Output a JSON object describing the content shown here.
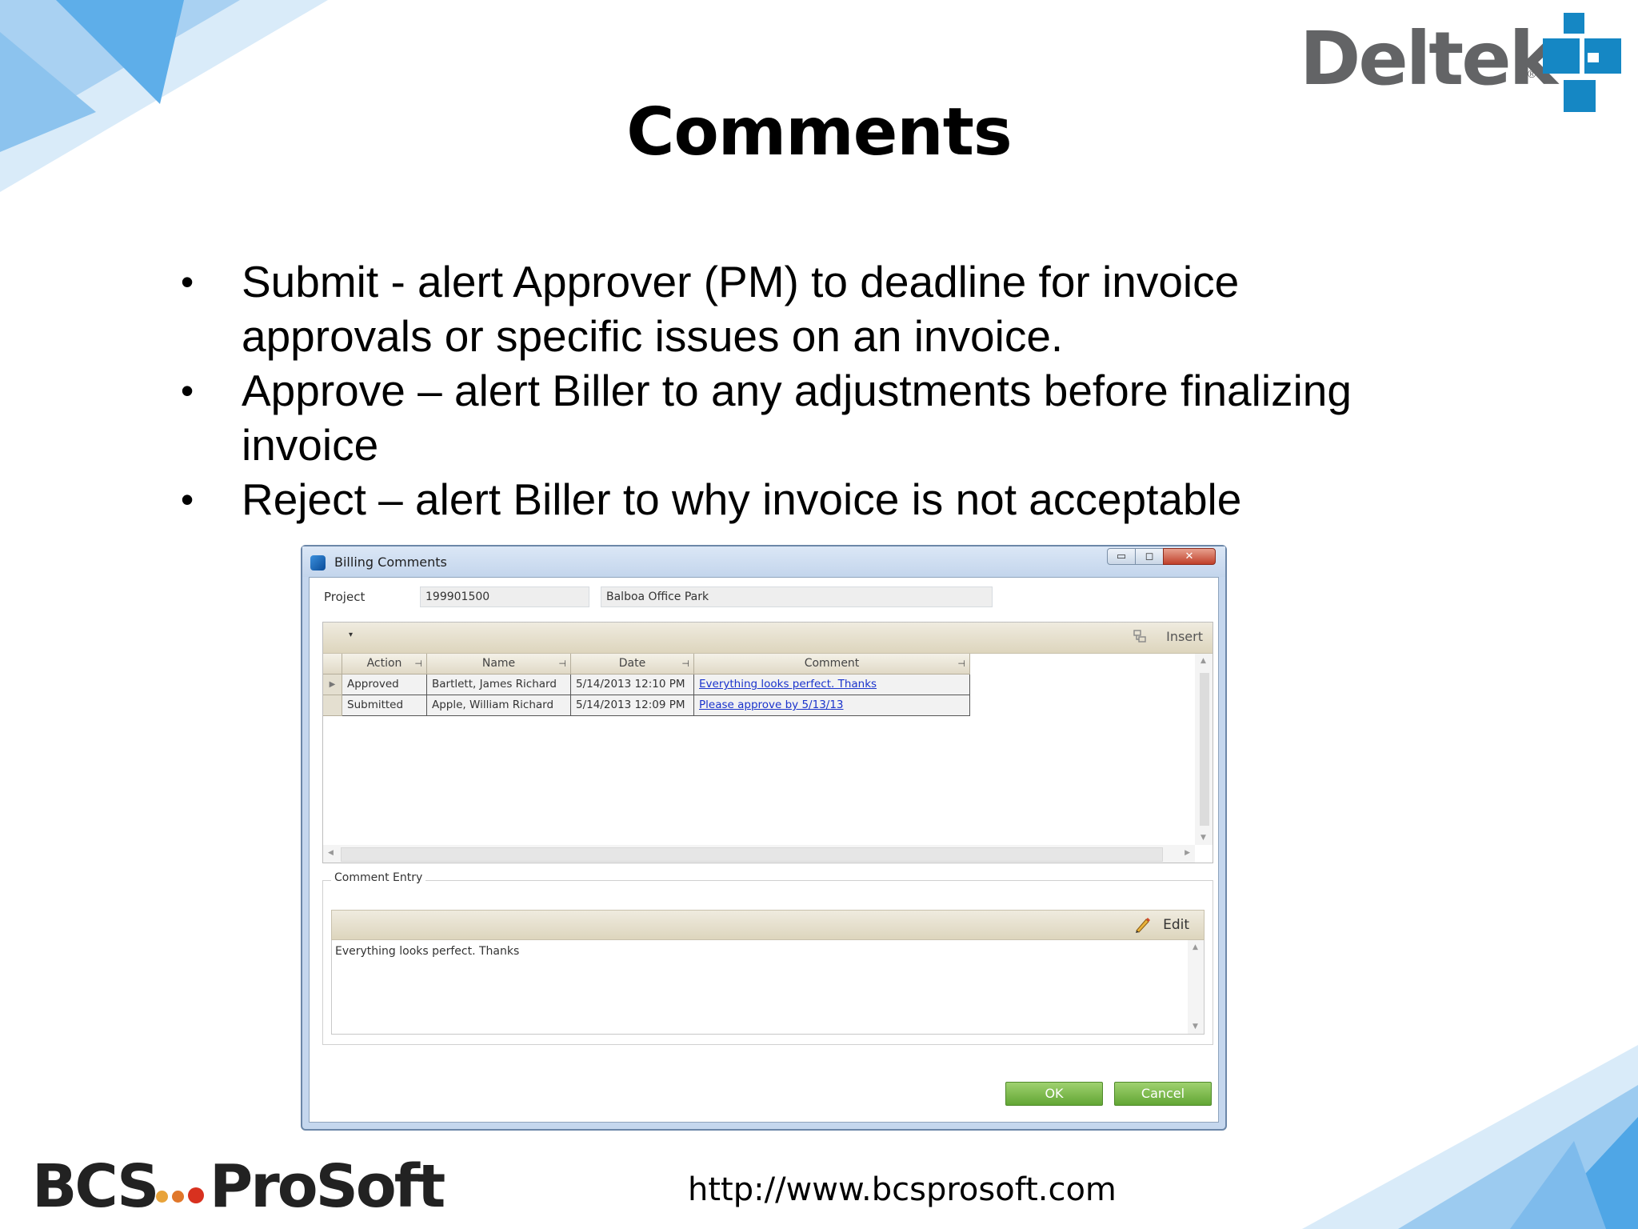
{
  "slide": {
    "title": "Comments",
    "bullets": [
      "Submit - alert Approver (PM) to deadline for invoice approvals or  specific issues on an invoice.",
      "Approve – alert Biller to any adjustments before finalizing invoice",
      "Reject – alert Biller to why invoice is not acceptable"
    ],
    "bullet_glyph": "•",
    "footer_url": "http://www.bcsprosoft.com",
    "logos": {
      "deltek": "Deltek",
      "deltek_mark": "®",
      "bcs_left": "BCS",
      "bcs_right": "ProSoft",
      "deltek_color": "#1587c4",
      "bcs_dot_colors": [
        "#e8a33a",
        "#e0772a",
        "#d8311f"
      ]
    }
  },
  "window": {
    "title": "Billing Comments",
    "controls": {
      "minimize": "▭",
      "maximize": "◻",
      "close": "✕"
    },
    "project": {
      "label": "Project",
      "number": "199901500",
      "name": "Balboa Office Park"
    },
    "grid": {
      "toolbar": {
        "dropdown_glyph": "▾",
        "insert_label": "Insert"
      },
      "columns": [
        "Action",
        "Name",
        "Date",
        "Comment"
      ],
      "pin_glyph": "⊣",
      "rows": [
        {
          "action": "Approved",
          "name": "Bartlett, James Richard",
          "date": "5/14/2013 12:10 PM",
          "comment": "Everything looks perfect. Thanks",
          "selected": true
        },
        {
          "action": "Submitted",
          "name": "Apple, William Richard",
          "date": "5/14/2013 12:09 PM",
          "comment": "Please approve by 5/13/13",
          "selected": false
        }
      ]
    },
    "comment_entry": {
      "legend": "Comment Entry",
      "edit_label": "Edit",
      "text": "Everything looks perfect. Thanks"
    },
    "buttons": {
      "ok": "OK",
      "cancel": "Cancel"
    },
    "colors": {
      "accent_green": "#62a634",
      "link_blue": "#1a33cc",
      "titlebar": "#c5d7ee"
    }
  }
}
